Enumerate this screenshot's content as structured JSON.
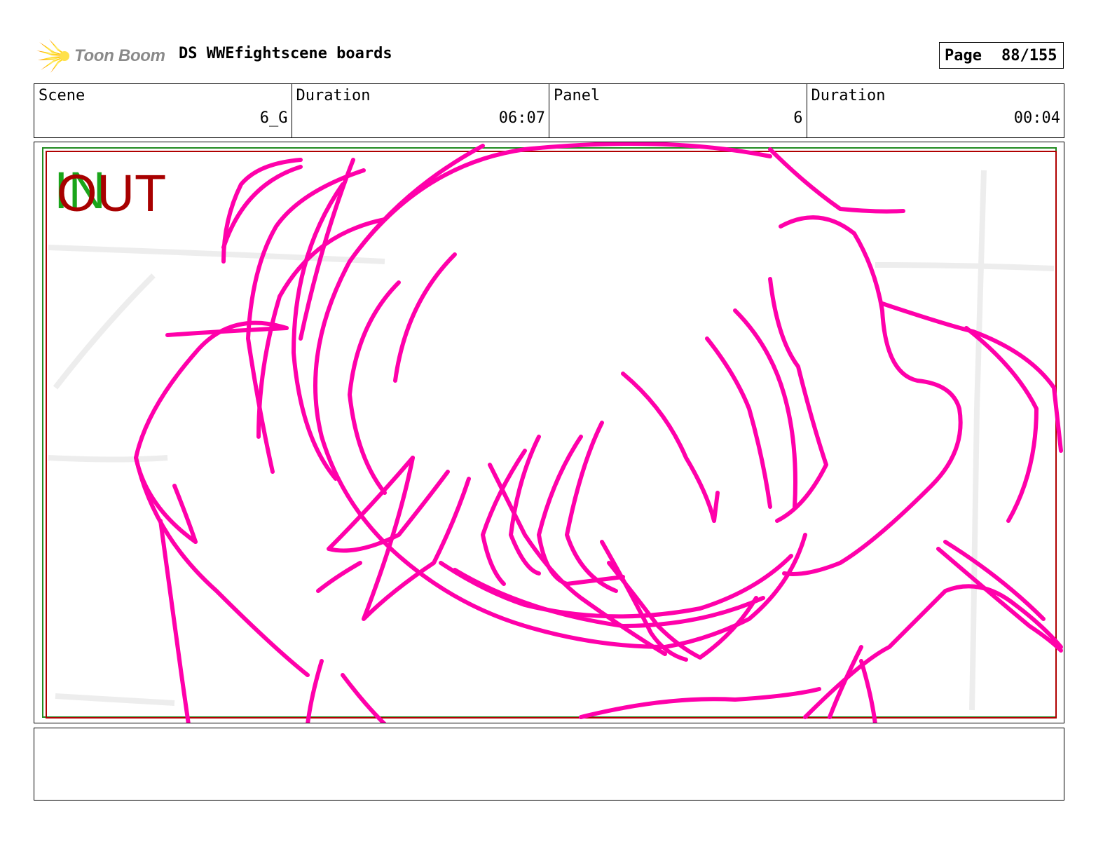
{
  "header": {
    "brand": "Toon Boom",
    "title": "DS WWEfightscene boards",
    "page_label": "Page",
    "page_value": "88/155"
  },
  "info": {
    "scene_label": "Scene",
    "scene_value": "6_G",
    "scene_duration_label": "Duration",
    "scene_duration_value": "06:07",
    "panel_label": "Panel",
    "panel_value": "6",
    "panel_duration_label": "Duration",
    "panel_duration_value": "00:04"
  },
  "panel": {
    "in_marker": "IN",
    "out_marker": "OUT",
    "sketch_color": "#ff00aa",
    "safe_frame_green": "#1f8a1f",
    "safe_frame_red": "#b00000"
  },
  "notes": {
    "text": ""
  }
}
